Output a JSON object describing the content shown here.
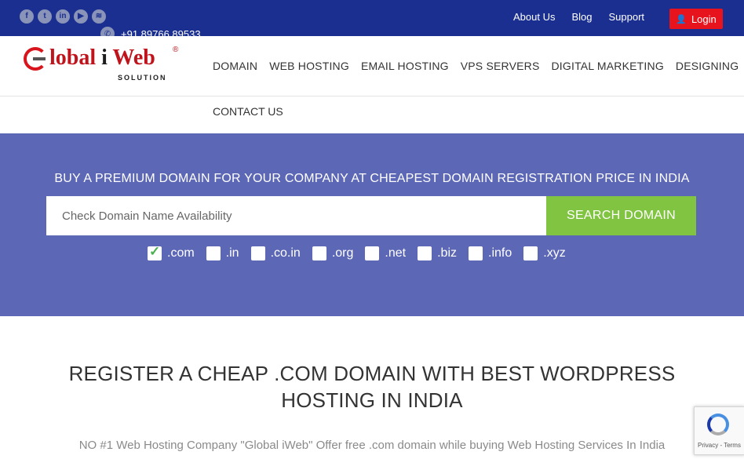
{
  "topbar": {
    "social": [
      {
        "icon": "facebook-icon",
        "glyph": "f"
      },
      {
        "icon": "twitter-icon",
        "glyph": "t"
      },
      {
        "icon": "linkedin-icon",
        "glyph": "in"
      },
      {
        "icon": "youtube-icon",
        "glyph": "▶"
      },
      {
        "icon": "rss-icon",
        "glyph": "≋"
      }
    ],
    "phone": "+91 89766 89533",
    "links": [
      "About Us",
      "Blog",
      "Support"
    ],
    "login_label": "Login"
  },
  "logo": {
    "word_part1": "lobal ",
    "word_part2": "i",
    "word_part3": " Web",
    "reg": "®",
    "sub": "SOLUTION"
  },
  "nav": {
    "items": [
      "DOMAIN",
      "WEB HOSTING",
      "EMAIL HOSTING",
      "VPS SERVERS",
      "DIGITAL MARKETING",
      "DESIGNING"
    ],
    "second_row": "CONTACT US"
  },
  "hero": {
    "heading": "BUY A PREMIUM DOMAIN FOR YOUR COMPANY AT CHEAPEST DOMAIN REGISTRATION PRICE IN INDIA",
    "search_placeholder": "Check Domain Name Availability",
    "search_button": "SEARCH DOMAIN",
    "tlds": [
      {
        "label": ".com",
        "checked": true
      },
      {
        "label": ".in",
        "checked": false
      },
      {
        "label": ".co.in",
        "checked": false
      },
      {
        "label": ".org",
        "checked": false
      },
      {
        "label": ".net",
        "checked": false
      },
      {
        "label": ".biz",
        "checked": false
      },
      {
        "label": ".info",
        "checked": false
      },
      {
        "label": ".xyz",
        "checked": false
      }
    ]
  },
  "main": {
    "title": "REGISTER A CHEAP .COM DOMAIN WITH BEST WORDPRESS HOSTING IN INDIA",
    "intro": "NO #1 Web Hosting Company \"Global iWeb\" Offer free .com domain while buying Web Hosting Services In India"
  },
  "recaptcha": {
    "text": "Privacy - Terms"
  },
  "colors": {
    "topbar": "#1a2f8f",
    "hero": "#5c67b5",
    "accent_green": "#80c441",
    "login_red": "#e8141d"
  }
}
